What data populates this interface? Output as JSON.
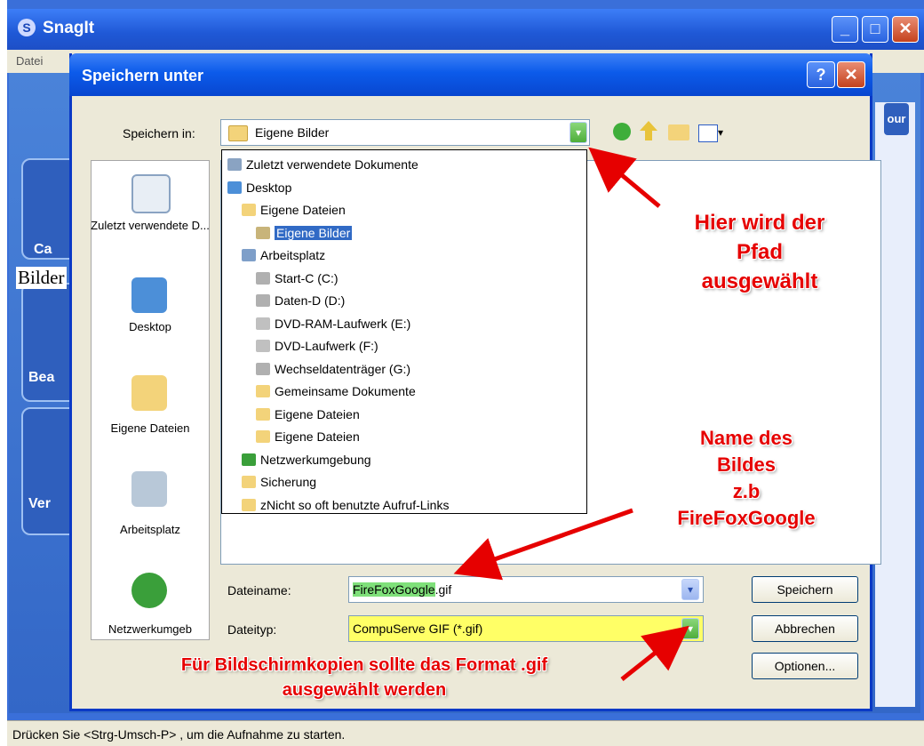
{
  "snagit": {
    "title": "SnagIt",
    "menu_datei": "Datei",
    "left_partial_1": "Ca",
    "left_partial_2": "Bea",
    "left_partial_3": "Ver",
    "tour_partial": "our",
    "status_text": "Drücken Sie  <Strg-Umsch-P> , um die Aufnahme zu starten.",
    "side_overlay_text": "Bilder"
  },
  "dialog": {
    "title": "Speichern unter",
    "help_label": "?",
    "close_label": "✕",
    "save_in_label": "Speichern in:",
    "save_in_value": "Eigene Bilder",
    "places": [
      {
        "label": "Zuletzt verwendete D...",
        "icon": "recent-documents-icon"
      },
      {
        "label": "Desktop",
        "icon": "desktop-icon"
      },
      {
        "label": "Eigene Dateien",
        "icon": "my-documents-icon"
      },
      {
        "label": "Arbeitsplatz",
        "icon": "my-computer-icon"
      },
      {
        "label": "Netzwerkumgeb",
        "icon": "network-icon"
      }
    ],
    "dropdown_items": [
      {
        "label": "Zuletzt verwendete Dokumente",
        "indent": 0,
        "icon": "recent-icon",
        "selected": false
      },
      {
        "label": "Desktop",
        "indent": 0,
        "icon": "desktop-icon",
        "selected": false
      },
      {
        "label": "Eigene Dateien",
        "indent": 1,
        "icon": "folder-icon",
        "selected": false
      },
      {
        "label": "Eigene Bilder",
        "indent": 2,
        "icon": "pictures-folder-icon",
        "selected": true
      },
      {
        "label": "Arbeitsplatz",
        "indent": 1,
        "icon": "computer-icon",
        "selected": false
      },
      {
        "label": "Start-C (C:)",
        "indent": 2,
        "icon": "drive-icon",
        "selected": false
      },
      {
        "label": "Daten-D (D:)",
        "indent": 2,
        "icon": "drive-icon",
        "selected": false
      },
      {
        "label": "DVD-RAM-Laufwerk (E:)",
        "indent": 2,
        "icon": "dvd-icon",
        "selected": false
      },
      {
        "label": "DVD-Laufwerk (F:)",
        "indent": 2,
        "icon": "dvd-icon",
        "selected": false
      },
      {
        "label": "Wechseldatenträger (G:)",
        "indent": 2,
        "icon": "drive-icon",
        "selected": false
      },
      {
        "label": "Gemeinsame Dokumente",
        "indent": 2,
        "icon": "folder-icon",
        "selected": false
      },
      {
        "label": "Eigene Dateien",
        "indent": 2,
        "icon": "folder-icon",
        "selected": false
      },
      {
        "label": "Eigene Dateien",
        "indent": 2,
        "icon": "folder-icon",
        "selected": false
      },
      {
        "label": "Netzwerkumgebung",
        "indent": 1,
        "icon": "network-icon",
        "selected": false
      },
      {
        "label": "Sicherung",
        "indent": 1,
        "icon": "folder-icon",
        "selected": false
      },
      {
        "label": "zNicht so oft benutzte Aufruf-Links",
        "indent": 1,
        "icon": "folder-icon",
        "selected": false
      }
    ],
    "filename_label": "Dateiname:",
    "filename_highlight": "FireFoxGoogle",
    "filename_ext": ".gif",
    "filetype_label": "Dateityp:",
    "filetype_value": "CompuServe GIF (*.gif)",
    "save_button": "Speichern",
    "cancel_button": "Abbrechen",
    "options_button": "Optionen..."
  },
  "annotations": {
    "path_note": [
      "Hier wird der",
      "Pfad",
      "ausgewählt"
    ],
    "name_note": [
      "Name des",
      "Bildes",
      "z.b",
      "FireFoxGoogle"
    ],
    "format_note": [
      "Für Bildschirmkopien sollte das Format .gif",
      "ausgewählt werden"
    ]
  },
  "colors": {
    "annotation_red": "#e60000",
    "selection_blue": "#316ac5",
    "filename_highlight": "#7fe07a",
    "filetype_highlight": "#ffff66"
  }
}
